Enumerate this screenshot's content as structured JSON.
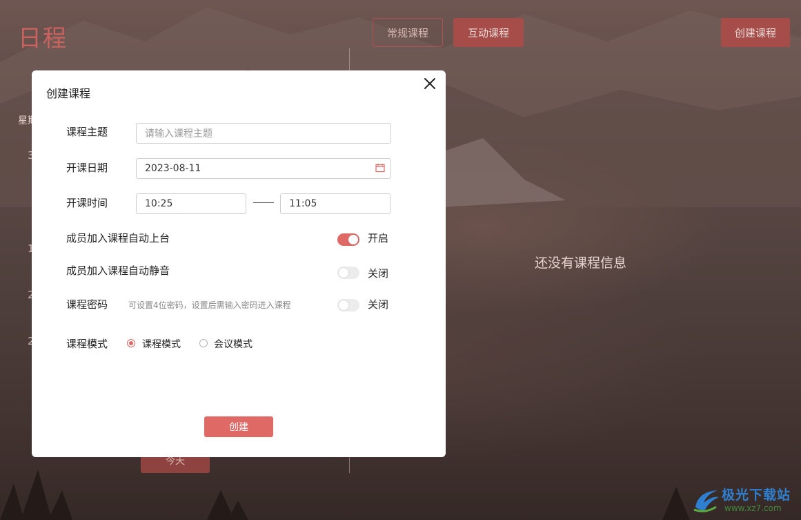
{
  "app": {
    "title": "日程",
    "tabs": {
      "regular": "常规课程",
      "interactive": "互动课程"
    },
    "create_course_button": "创建课程",
    "weekday_fragment": "星期",
    "day_fragments": [
      "3",
      "1",
      "2",
      "2"
    ],
    "today_button": "今天",
    "empty_message": "还没有课程信息"
  },
  "modal": {
    "title": "创建课程",
    "fields": {
      "topic_label": "课程主题",
      "topic_placeholder": "请输入课程主题",
      "date_label": "开课日期",
      "date_value": "2023-08-11",
      "time_label": "开课时间",
      "start_time": "10:25",
      "end_time": "11:05"
    },
    "toggles": {
      "auto_stage_label": "成员加入课程自动上台",
      "auto_stage_state": "开启",
      "auto_mute_label": "成员加入课程自动静音",
      "auto_mute_state": "关闭",
      "password_label": "课程密码",
      "password_hint": "可设置4位密码，设置后需输入密码进入课程",
      "password_state": "关闭"
    },
    "mode": {
      "label": "课程模式",
      "options": [
        "课程模式",
        "会议模式"
      ],
      "selected": "课程模式"
    },
    "submit_button": "创建"
  },
  "watermark": {
    "name": "极光下载站",
    "url": "www.xz7.com"
  },
  "colors": {
    "accent": "#de6965",
    "title_red": "#c9625f"
  }
}
